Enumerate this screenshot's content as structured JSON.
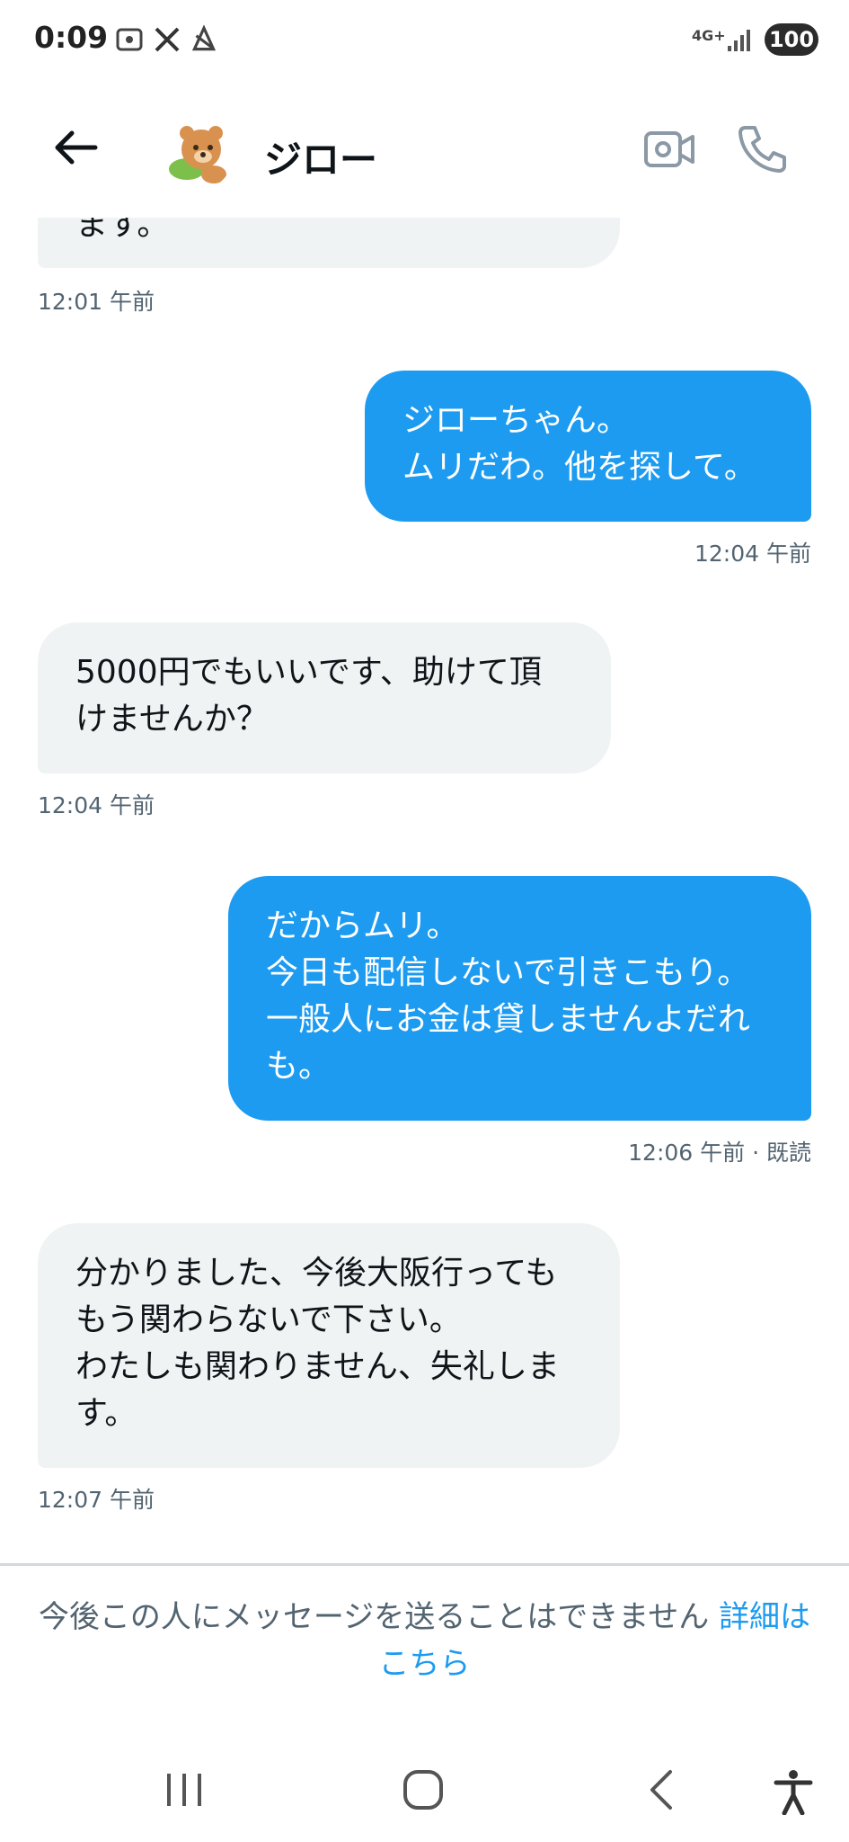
{
  "status_bar": {
    "time": "0:09",
    "network": "4G+",
    "battery": "100"
  },
  "header": {
    "contact_name": "ジロー",
    "icons": [
      "back-arrow-icon",
      "video-call-icon",
      "phone-icon"
    ]
  },
  "messages": [
    {
      "direction": "in",
      "text": "ます。",
      "timestamp": "12:01 午前"
    },
    {
      "direction": "out",
      "text": "ジローちゃん。\nムリだわ。他を探して。",
      "timestamp": "12:04 午前"
    },
    {
      "direction": "in",
      "text": "5000円でもいいです、助けて頂\nけませんか？",
      "timestamp": "12:04 午前"
    },
    {
      "direction": "out",
      "text": "だからムリ。\n今日も配信しないで引きこもり。\n一般人にお金は貸しませんよだれ\nも。",
      "timestamp": "12:06 午前 · 既読"
    },
    {
      "direction": "in",
      "text": "分かりました、今後大阪行っても\nもう関わらないで下さい。\nわたしも関わりません、失礼しま\nす。",
      "timestamp": "12:07 午前"
    }
  ],
  "footer": {
    "notice_text": "今後この人にメッセージを送ることはできません",
    "notice_link": "詳細はこちら"
  },
  "colors": {
    "accent": "#1d9bf0",
    "incoming_bubble": "#eff3f4",
    "secondary_text": "#536471"
  }
}
